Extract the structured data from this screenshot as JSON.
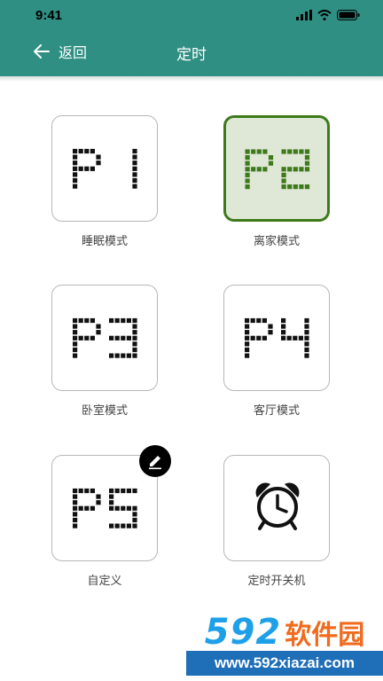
{
  "status": {
    "time": "9:41"
  },
  "header": {
    "back_label": "返回",
    "title": "定时"
  },
  "modes": [
    {
      "code": "P1",
      "label": "睡眠模式",
      "selected": false
    },
    {
      "code": "P2",
      "label": "离家模式",
      "selected": true
    },
    {
      "code": "P3",
      "label": "卧室模式",
      "selected": false
    },
    {
      "code": "P4",
      "label": "客厅模式",
      "selected": false
    },
    {
      "code": "P5",
      "label": "自定义",
      "selected": false
    },
    {
      "code": "",
      "label": "定时开关机",
      "selected": false
    }
  ],
  "colors": {
    "primary": "#2f8f83",
    "selected_border": "#3e7a1c",
    "selected_bg": "#dfe7d6",
    "selected_glyph": "#3e7a1c",
    "glyph": "#111111"
  },
  "watermark": {
    "digits": "592",
    "text": "软件园",
    "url": "www.592xiazai.com"
  }
}
